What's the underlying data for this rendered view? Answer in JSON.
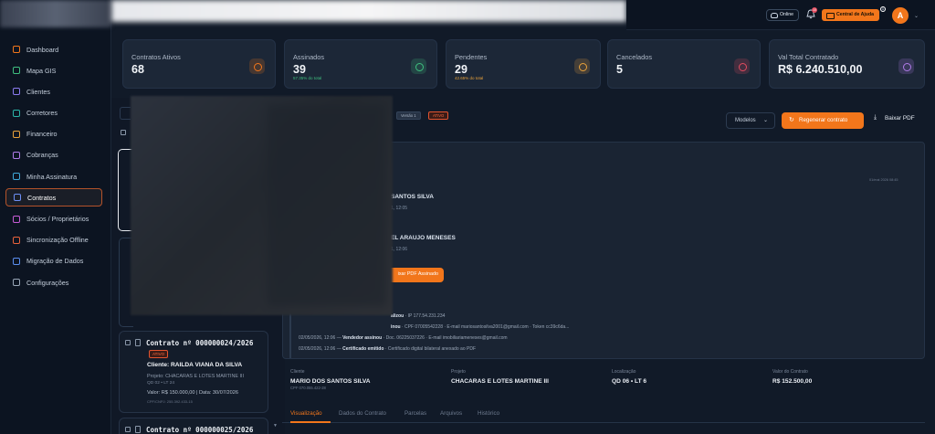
{
  "topbar": {
    "online_label": "Online",
    "notif_count": "10",
    "help_label": "Central de Ajuda",
    "help_badge": "1",
    "avatar_initial": "A",
    "menu_chevron": "⌄"
  },
  "sidebar": {
    "items": [
      {
        "label": "Dashboard",
        "icon": "dashboard-icon",
        "color": "#f2761b"
      },
      {
        "label": "Mapa GIS",
        "icon": "map-icon",
        "color": "#3fbf7f"
      },
      {
        "label": "Clientes",
        "icon": "users-icon",
        "color": "#8b7bf0"
      },
      {
        "label": "Corretores",
        "icon": "user-group-icon",
        "color": "#2bb5a8"
      },
      {
        "label": "Financeiro",
        "icon": "finance-icon",
        "color": "#e9a23b"
      },
      {
        "label": "Cobranças",
        "icon": "billing-icon",
        "color": "#b07be8"
      },
      {
        "label": "Minha Assinatura",
        "icon": "subscription-icon",
        "color": "#3fa8d8"
      },
      {
        "label": "Contratos",
        "icon": "contract-icon",
        "color": "#6d8ff5",
        "active": true
      },
      {
        "label": "Sócios / Proprietários",
        "icon": "partners-icon",
        "color": "#c75bd6"
      },
      {
        "label": "Sincronização Offline",
        "icon": "sync-icon",
        "color": "#e8623b"
      },
      {
        "label": "Migração de Dados",
        "icon": "migration-icon",
        "color": "#5b8ff0"
      },
      {
        "label": "Configurações",
        "icon": "gear-icon",
        "color": "#9aa7b8"
      }
    ]
  },
  "stats": [
    {
      "label": "Contratos Ativos",
      "value": "68",
      "sub": "",
      "icon": "document-icon",
      "color": "#f2761b"
    },
    {
      "label": "Assinados",
      "value": "39",
      "sub": "57.35% do total",
      "sub_color": "#3fbf7f",
      "icon": "check-circle-icon",
      "color": "#3fbf7f"
    },
    {
      "label": "Pendentes",
      "value": "29",
      "sub": "42.65% do total",
      "sub_color": "#e9a23b",
      "icon": "clock-icon",
      "color": "#e9a23b"
    },
    {
      "label": "Cancelados",
      "value": "5",
      "sub": "",
      "icon": "x-circle-icon",
      "color": "#e34b5f"
    },
    {
      "label": "Val Total Contratado",
      "value": "R$ 6.240.510,00",
      "sub": "",
      "icon": "wallet-icon",
      "color": "#b07be8"
    }
  ],
  "contracts": [
    {
      "number": "Contrato nº 000000024/2026",
      "status": "ATIVO",
      "client": "Cliente: RAILDA VIANA DA SILVA",
      "project": "Projeto: CHACARAS E LOTES MARTINE III",
      "lot": "QD 02 • LT 24",
      "value_date": "Valor: R$ 150.000,00  |  Data: 30/07/2026",
      "cpf": "CPF/CNPJ: 255.392.433-15"
    },
    {
      "number": "Contrato nº 000000025/2026"
    }
  ],
  "detail": {
    "version": "Versão 1",
    "status": "ATIVO",
    "modelos_label": "Modelos",
    "regen_label": "Regenerar contrato",
    "download_label": "Baixar PDF",
    "doc_date": "01/mai 2026 08:45",
    "signer1_name": "SANTOS SILVA",
    "signer1_date": "1, 12:05",
    "signer2_name": "EL ARAUJO MENESES",
    "signer2_date": "1, 12:06",
    "pdf_button": "ixar PDF Assinado",
    "log": [
      {
        "prefix": "",
        "bold": "alizou",
        "text": " · IP 177.54.231.234"
      },
      {
        "prefix": "",
        "bold": "inou",
        "text": " · CPF 07005542228 · E-mail mariosantosilva2001@gmail.com · Token cc39c6da..."
      },
      {
        "prefix": "02/05/2026, 12:06 — ",
        "bold": "Vendedor assinou",
        "text": " · Doc. 06225037226 · E-mail imobiliariameneses@gmail.com"
      },
      {
        "prefix": "02/05/2026, 12:06 — ",
        "bold": "Certificado emitido",
        "text": " · Certificado digital bilateral anexado ao PDF"
      }
    ],
    "info": [
      {
        "label": "Cliente",
        "value": "MARIO DOS SANTOS SILVA",
        "sub": "CPF 070.055.422-28"
      },
      {
        "label": "Projeto",
        "value": "CHACARAS E LOTES MARTINE III",
        "sub": ""
      },
      {
        "label": "Localização",
        "value": "QD 06 • LT 6",
        "sub": ""
      },
      {
        "label": "Valor do Contrato",
        "value": "R$ 152.500,00",
        "sub": ""
      }
    ],
    "tabs": [
      "Visualização",
      "Dados do Contrato",
      "Parcelas",
      "Arquivos",
      "Histórico"
    ]
  }
}
